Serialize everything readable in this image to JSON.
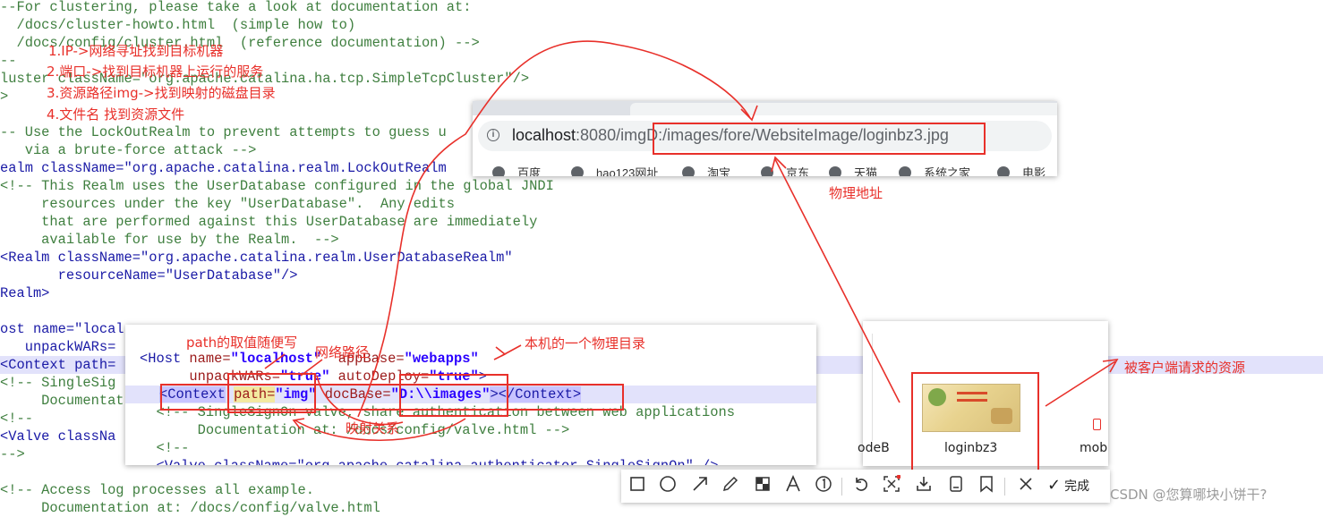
{
  "background_code": [
    {
      "t": "--For clustering, please take a look at documentation at:",
      "k": "comment"
    },
    {
      "t": "  /docs/cluster-howto.html  (simple how to)",
      "k": "comment"
    },
    {
      "t": "  /docs/config/cluster.html  (reference documentation) -->",
      "k": "comment"
    },
    {
      "t": "--",
      "k": "comment"
    },
    {
      "t": "luster className=\"org.apache.catalina.ha.tcp.SimpleTcpCluster\"/>",
      "k": "comment"
    },
    {
      "t": ">",
      "k": "comment"
    },
    {
      "t": "",
      "k": "plain"
    },
    {
      "t": "-- Use the LockOutRealm to prevent attempts to guess u",
      "k": "comment"
    },
    {
      "t": "   via a brute-force attack -->",
      "k": "comment"
    },
    {
      "t": "ealm className=\"org.apache.catalina.realm.LockOutRealm",
      "k": "tag"
    },
    {
      "t": "<!-- This Realm uses the UserDatabase configured in the global JNDI",
      "k": "comment"
    },
    {
      "t": "     resources under the key \"UserDatabase\".  Any edits",
      "k": "comment"
    },
    {
      "t": "     that are performed against this UserDatabase are immediately",
      "k": "comment"
    },
    {
      "t": "     available for use by the Realm.  -->",
      "k": "comment"
    },
    {
      "t": "<Realm className=\"org.apache.catalina.realm.UserDatabaseRealm\"",
      "k": "tag"
    },
    {
      "t": "       resourceName=\"UserDatabase\"/>",
      "k": "tag"
    },
    {
      "t": "Realm>",
      "k": "tag"
    },
    {
      "t": "",
      "k": "plain"
    },
    {
      "t": "ost name=\"local",
      "k": "tag"
    },
    {
      "t": "   unpackWARs=",
      "k": "tag"
    },
    {
      "t": "<Context path=",
      "k": "tag"
    },
    {
      "t": "<!-- SingleSig",
      "k": "comment"
    },
    {
      "t": "     Documentat",
      "k": "comment"
    },
    {
      "t": "<!--",
      "k": "comment"
    },
    {
      "t": "<Valve classNa",
      "k": "tag"
    },
    {
      "t": "-->",
      "k": "comment"
    },
    {
      "t": "",
      "k": "plain"
    },
    {
      "t": "<!-- Access log processes all example.",
      "k": "comment"
    },
    {
      "t": "     Documentation at: /docs/config/valve.html",
      "k": "comment"
    }
  ],
  "annotations": {
    "steps": [
      "1.IP->网络寻址找到目标机器",
      "2.端口->找到目标机器上运行的服务",
      "3.资源路径img->找到映射的磁盘目录",
      "4.文件名 找到资源文件"
    ],
    "physical_address": "物理地址",
    "path_any": "path的取值随便写",
    "network_path": "网络路径",
    "local_dir": "本机的一个物理目录",
    "mapping": "映射关系",
    "requested_resource": "被客户端请求的资源"
  },
  "browser": {
    "url_host": "localhost",
    "url_rest": ":8080/imgD:/images/fore/WebsiteImage/loginbz3.jpg",
    "bookmarks": [
      "百度",
      "hao123网址",
      "淘宝",
      "京东",
      "天猫",
      "系统之家",
      "电影"
    ]
  },
  "editor": {
    "lines": [
      "<Host name=\"localhost\"  appBase=\"webapps\"",
      "      unpackWARs=\"true\" autoDeploy=\"true\">",
      "<Context path=\"img\" docBase=\"D:\\\\images\"></Context>",
      "  <!-- SingleSignOn valve, share authentication between web applications",
      "       Documentation at: /docs/config/valve.html -->",
      "  <!--",
      "  <Valve className=\"org.apache.catalina.authenticator.SingleSignOn\" />"
    ]
  },
  "explorer": {
    "files": [
      "odeB",
      "loginbz3",
      "mob"
    ]
  },
  "toolbar": {
    "tools": [
      "rect-icon",
      "ellipse-icon",
      "arrow-icon",
      "pen-icon",
      "mosaic-icon",
      "text-icon",
      "number-icon",
      "undo-icon",
      "pin-icon",
      "download-icon",
      "save-icon",
      "bookmark-icon",
      "close-icon"
    ],
    "done_label": "完成"
  },
  "watermark": "CSDN @您算哪块小饼干?"
}
